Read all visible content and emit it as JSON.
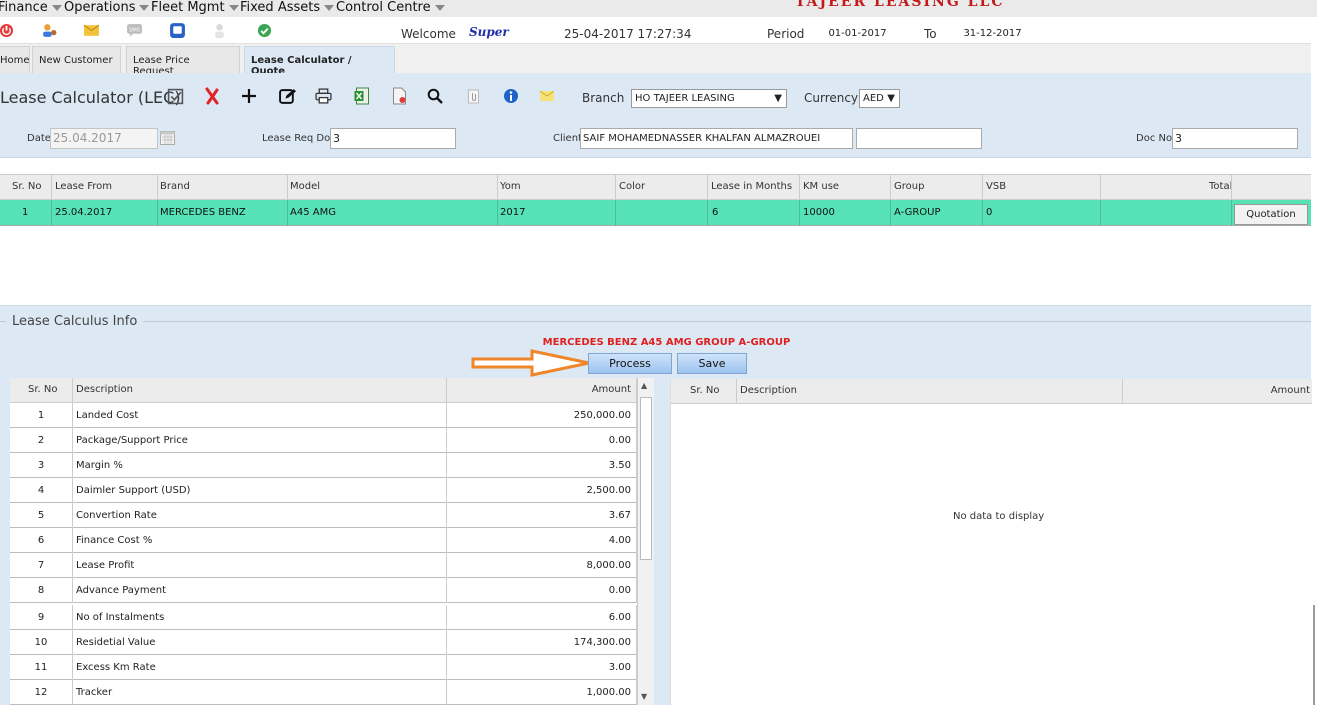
{
  "menu": [
    "Finance",
    "Operations",
    "Fleet Mgmt",
    "Fixed Assets",
    "Control Centre"
  ],
  "brand": "TAJEER LEASING LLC",
  "header": {
    "welcome_label": "Welcome",
    "user": "Super",
    "datetime": "25-04-2017 17:27:34",
    "period_label": "Period",
    "period_from": "01-01-2017",
    "to_label": "To",
    "period_to": "31-12-2017"
  },
  "tabs": [
    "Home",
    "New Customer",
    "Lease Price Request",
    "Lease Calculator / Quote"
  ],
  "toolbar": {
    "title": "Lease Calculator (LEC)",
    "branch_label": "Branch",
    "branch_value": "HO TAJEER LEASING",
    "currency_label": "Currency",
    "currency_value": "AED"
  },
  "filters": {
    "date_label": "Date",
    "date_value": "25.04.2017",
    "lease_req_label": "Lease Req Doc",
    "lease_req_value": "3",
    "client_label": "Client",
    "client_value": "SAIF MOHAMEDNASSER KHALFAN ALMAZROUEI",
    "doc_no_label": "Doc No",
    "doc_no_value": "3"
  },
  "grid": {
    "headers": [
      "Sr. No",
      "Lease From",
      "Brand",
      "Model",
      "Yom",
      "Color",
      "Lease in Months",
      "KM use",
      "Group",
      "VSB",
      "Total"
    ],
    "row": {
      "sr": "1",
      "lease_from": "25.04.2017",
      "brand": "MERCEDES BENZ",
      "model": "A45 AMG",
      "yom": "2017",
      "color": "",
      "months": "6",
      "km": "10000",
      "group": "A-GROUP",
      "vsb": "0",
      "total": ""
    },
    "action_label": "Quotation"
  },
  "calc": {
    "legend": "Lease Calculus Info",
    "caption": "MERCEDES BENZ A45 AMG GROUP A-GROUP",
    "process_label": "Process",
    "save_label": "Save",
    "left_headers": [
      "Sr. No",
      "Description",
      "Amount"
    ],
    "left_rows": [
      {
        "sr": "1",
        "desc": "Landed Cost",
        "amount": "250,000.00"
      },
      {
        "sr": "2",
        "desc": "Package/Support Price",
        "amount": "0.00"
      },
      {
        "sr": "3",
        "desc": "Margin %",
        "amount": "3.50"
      },
      {
        "sr": "4",
        "desc": "Daimler Support (USD)",
        "amount": "2,500.00"
      },
      {
        "sr": "5",
        "desc": "Convertion Rate",
        "amount": "3.67"
      },
      {
        "sr": "6",
        "desc": "Finance Cost %",
        "amount": "4.00"
      },
      {
        "sr": "7",
        "desc": "Lease Profit",
        "amount": "8,000.00"
      },
      {
        "sr": "8",
        "desc": "Advance Payment",
        "amount": "0.00"
      },
      {
        "sr": "9",
        "desc": "No of Instalments",
        "amount": "6.00"
      },
      {
        "sr": "10",
        "desc": "Residetial Value",
        "amount": "174,300.00"
      },
      {
        "sr": "11",
        "desc": "Excess Km Rate",
        "amount": "3.00"
      },
      {
        "sr": "12",
        "desc": "Tracker",
        "amount": "1,000.00"
      }
    ],
    "right_headers": [
      "Sr. No",
      "Description",
      "Amount"
    ],
    "no_data": "No data to display"
  },
  "colors": {
    "accent": "#dce9f5",
    "row_highlight": "#57e2b6",
    "brand_red": "#c31a1a",
    "arrow": "#f0862a"
  }
}
